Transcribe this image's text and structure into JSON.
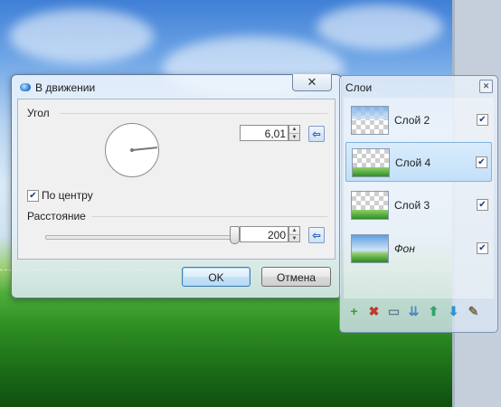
{
  "motion_dialog": {
    "title": "В движении",
    "close_glyph": "✕",
    "angle": {
      "label": "Угол",
      "value": "6,01"
    },
    "centered": {
      "label": "По центру",
      "checked": true
    },
    "distance": {
      "label": "Расстояние",
      "value": "200",
      "slider_fraction": 0.97
    },
    "ok_label": "OK",
    "cancel_label": "Отмена",
    "reset_glyph": "⇦",
    "check_glyph": "✔",
    "spin_up": "▲",
    "spin_down": "▼"
  },
  "layers_panel": {
    "title": "Слои",
    "close_glyph": "✕",
    "layers": [
      {
        "name": "Слой 2",
        "visible": true,
        "selected": false,
        "thumb": "sky-transparent"
      },
      {
        "name": "Слой 4",
        "visible": true,
        "selected": true,
        "thumb": "grass-transparent"
      },
      {
        "name": "Слой 3",
        "visible": true,
        "selected": false,
        "thumb": "grass-transparent"
      },
      {
        "name": "Фон",
        "visible": true,
        "selected": false,
        "thumb": "full-landscape"
      }
    ],
    "toolbar_icons": [
      "add-layer-icon",
      "delete-layer-icon",
      "duplicate-layer-icon",
      "merge-down-icon",
      "move-up-icon",
      "move-down-icon",
      "properties-icon"
    ],
    "toolbar_glyphs": [
      "+",
      "✖",
      "▭",
      "⇊",
      "⬆",
      "⬇",
      "✎"
    ]
  },
  "colors": {
    "accent": "#3c7fb1",
    "selection": "#c2e0f8",
    "delete_red": "#c0392b",
    "arrow_blue": "#2f8fd6"
  }
}
